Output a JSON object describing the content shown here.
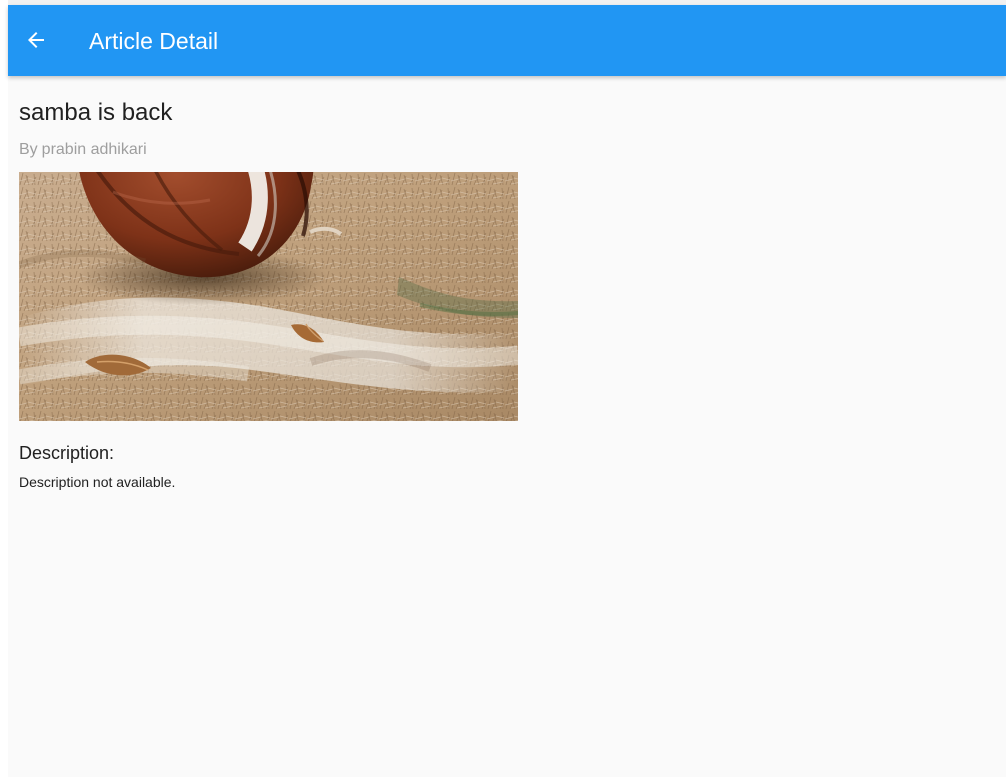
{
  "app_bar": {
    "title": "Article Detail",
    "back_icon": "arrow-back-icon",
    "background_color": "#2196f3",
    "text_color": "#ffffff"
  },
  "article": {
    "title": "samba is back",
    "author_prefix": "By",
    "author": "prabin adhikari",
    "image": {
      "icon": "football-photo"
    },
    "description_heading": "Description:",
    "description": "Description not available."
  },
  "theme": {
    "page_background": "#fafafa",
    "secondary_text": "#9e9e9e",
    "primary_text": "#212121"
  }
}
